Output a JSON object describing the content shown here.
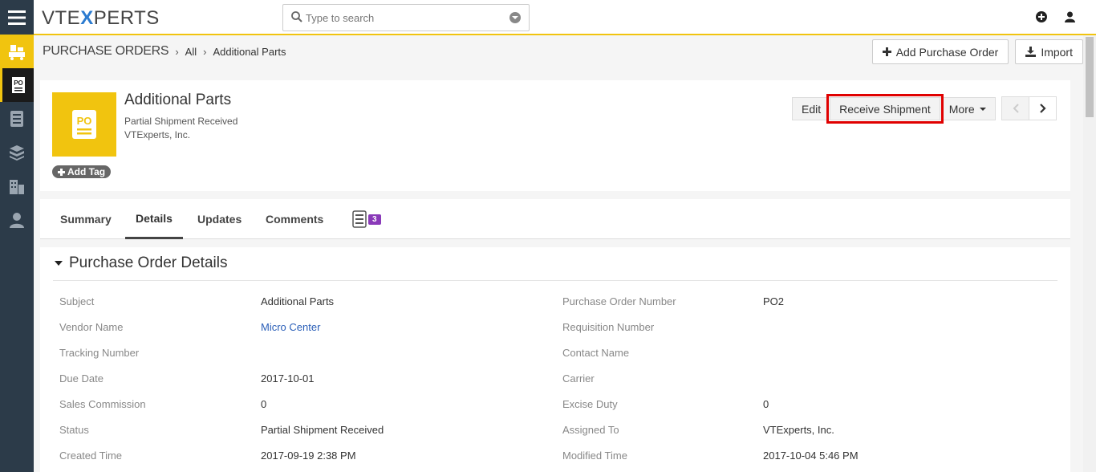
{
  "app": {
    "logo_text": "VTE",
    "logo_x": "X",
    "logo_rest": "PERTS"
  },
  "search": {
    "placeholder": "Type to search"
  },
  "breadcrumb": {
    "module": "PURCHASE ORDERS",
    "level1": "All",
    "level2": "Additional Parts"
  },
  "header_actions": {
    "add_label": "Add Purchase Order",
    "import_label": "Import"
  },
  "record": {
    "icon_text": "PO",
    "title": "Additional Parts",
    "status": "Partial Shipment Received",
    "vendor": "VTExperts, Inc.",
    "add_tag": "Add Tag"
  },
  "record_actions": {
    "edit": "Edit",
    "receive": "Receive Shipment",
    "more": "More"
  },
  "tabs": [
    {
      "label": "Summary"
    },
    {
      "label": "Details"
    },
    {
      "label": "Updates"
    },
    {
      "label": "Comments"
    }
  ],
  "related_count": "3",
  "section": {
    "title": "Purchase Order Details"
  },
  "fields": [
    {
      "l1": "Subject",
      "v1": "Additional Parts",
      "l2": "Purchase Order Number",
      "v2": "PO2"
    },
    {
      "l1": "Vendor Name",
      "v1": "Micro Center",
      "l2": "Requisition Number",
      "v2": ""
    },
    {
      "l1": "Tracking Number",
      "v1": "",
      "l2": "Contact Name",
      "v2": ""
    },
    {
      "l1": "Due Date",
      "v1": "2017-10-01",
      "l2": "Carrier",
      "v2": ""
    },
    {
      "l1": "Sales Commission",
      "v1": "0",
      "l2": "Excise Duty",
      "v2": "0"
    },
    {
      "l1": "Status",
      "v1": "Partial Shipment Received",
      "l2": "Assigned To",
      "v2": "VTExperts, Inc."
    },
    {
      "l1": "Created Time",
      "v1": "2017-09-19 2:38 PM",
      "l2": "Modified Time",
      "v2": "2017-10-04 5:46 PM"
    }
  ],
  "colors": {
    "accent": "#f1c40f",
    "rail": "#2c3b49",
    "highlight": "#e00000",
    "badge": "#8a3ab9",
    "link": "#2b5fb8"
  }
}
